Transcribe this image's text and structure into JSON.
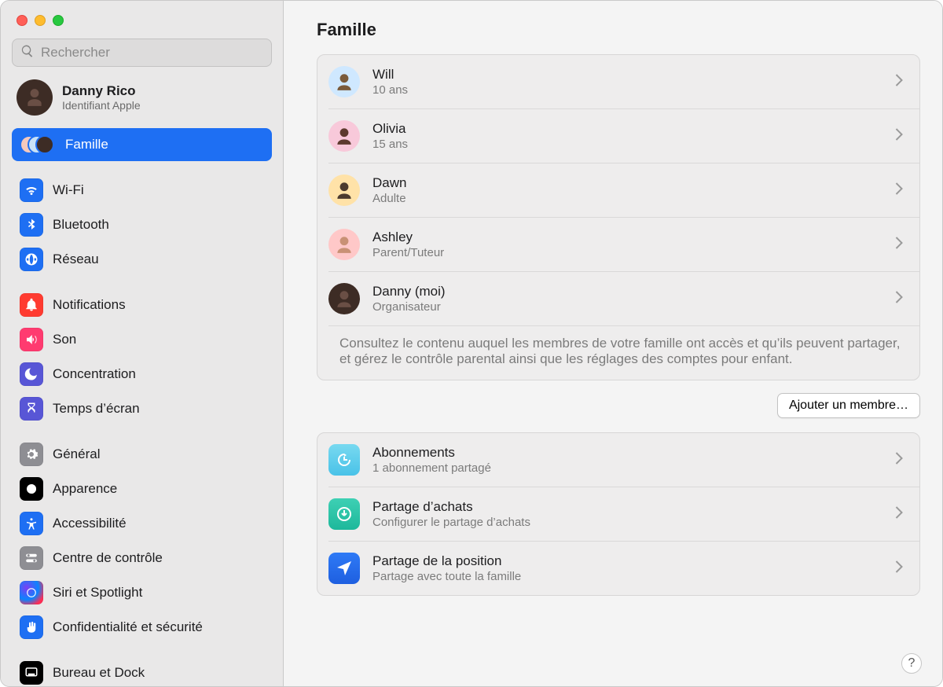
{
  "search": {
    "placeholder": "Rechercher"
  },
  "account": {
    "name": "Danny Rico",
    "subtitle": "Identifiant Apple"
  },
  "page": {
    "title": "Famille",
    "add_member_label": "Ajouter un membre…",
    "help_label": "?"
  },
  "sidebar": {
    "items": [
      {
        "id": "famille",
        "label": "Famille",
        "selected": true,
        "iconBg": "family",
        "iconName": "family-icon"
      },
      {
        "id": "wifi",
        "label": "Wi-Fi",
        "selected": false,
        "iconBg": "#1e6ff3",
        "iconName": "wifi-icon"
      },
      {
        "id": "bluetooth",
        "label": "Bluetooth",
        "selected": false,
        "iconBg": "#1e6ff3",
        "iconName": "bluetooth-icon"
      },
      {
        "id": "reseau",
        "label": "Réseau",
        "selected": false,
        "iconBg": "#1e6ff3",
        "iconName": "globe-icon"
      },
      {
        "id": "notifications",
        "label": "Notifications",
        "selected": false,
        "iconBg": "#ff3b30",
        "iconName": "bell-icon"
      },
      {
        "id": "son",
        "label": "Son",
        "selected": false,
        "iconBg": "#ff3b70",
        "iconName": "speaker-icon"
      },
      {
        "id": "concentration",
        "label": "Concentration",
        "selected": false,
        "iconBg": "#5856d6",
        "iconName": "moon-icon"
      },
      {
        "id": "temps-ecran",
        "label": "Temps d’écran",
        "selected": false,
        "iconBg": "#5856d6",
        "iconName": "hourglass-icon"
      },
      {
        "id": "general",
        "label": "Général",
        "selected": false,
        "iconBg": "#8e8e93",
        "iconName": "gear-icon"
      },
      {
        "id": "apparence",
        "label": "Apparence",
        "selected": false,
        "iconBg": "#000000",
        "iconName": "appearance-icon"
      },
      {
        "id": "accessibilite",
        "label": "Accessibilité",
        "selected": false,
        "iconBg": "#1e6ff3",
        "iconName": "accessibility-icon"
      },
      {
        "id": "centre-controle",
        "label": "Centre de contrôle",
        "selected": false,
        "iconBg": "#8e8e93",
        "iconName": "switches-icon"
      },
      {
        "id": "siri",
        "label": "Siri et Spotlight",
        "selected": false,
        "iconBg": "siri",
        "iconName": "siri-icon"
      },
      {
        "id": "confidentialite",
        "label": "Confidentialité et sécurité",
        "selected": false,
        "iconBg": "#1e6ff3",
        "iconName": "hand-icon"
      },
      {
        "id": "bureau-dock",
        "label": "Bureau et Dock",
        "selected": false,
        "iconBg": "#000000",
        "iconName": "dock-icon"
      }
    ]
  },
  "members": [
    {
      "name": "Will",
      "subtitle": "10 ans",
      "avatarClass": "m-will"
    },
    {
      "name": "Olivia",
      "subtitle": "15 ans",
      "avatarClass": "m-olivia"
    },
    {
      "name": "Dawn",
      "subtitle": "Adulte",
      "avatarClass": "m-dawn"
    },
    {
      "name": "Ashley",
      "subtitle": "Parent/Tuteur",
      "avatarClass": "m-ashley"
    },
    {
      "name": "Danny (moi)",
      "subtitle": "Organisateur",
      "avatarClass": "m-danny"
    }
  ],
  "members_description": "Consultez le contenu auquel les membres de votre famille ont accès et qu’ils peuvent partager, et gérez le contrôle parental ainsi que les réglages des comptes pour enfant.",
  "features": [
    {
      "title": "Abonnements",
      "subtitle": "1 abonnement partagé",
      "iconClass": "f-sub",
      "iconName": "subscriptions-icon"
    },
    {
      "title": "Partage d’achats",
      "subtitle": "Configurer le partage d’achats",
      "iconClass": "f-purc",
      "iconName": "purchase-sharing-icon"
    },
    {
      "title": "Partage de la position",
      "subtitle": "Partage avec toute la famille",
      "iconClass": "f-loc",
      "iconName": "location-sharing-icon"
    }
  ]
}
